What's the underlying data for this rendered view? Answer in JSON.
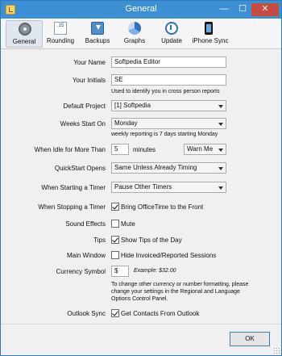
{
  "window": {
    "title": "General",
    "minimize": "—",
    "maximize": "☐",
    "close": "✕"
  },
  "toolbar": {
    "items": [
      {
        "label": "General",
        "icon": "general-icon",
        "active": true
      },
      {
        "label": "Rounding",
        "icon": "rounding-icon",
        "icon_text": ".15"
      },
      {
        "label": "Backups",
        "icon": "backups-icon"
      },
      {
        "label": "Graphs",
        "icon": "graphs-icon"
      },
      {
        "label": "Update",
        "icon": "update-icon"
      },
      {
        "label": "iPhone Sync",
        "icon": "iphone-icon"
      }
    ]
  },
  "form": {
    "your_name": {
      "label": "Your Name",
      "value": "Softpedia Editor"
    },
    "your_initials": {
      "label": "Your Initials",
      "value": "SE",
      "hint": "Used to identify you in cross person reports"
    },
    "default_project": {
      "label": "Default Project",
      "value": "[1] Softpedia"
    },
    "weeks_start_on": {
      "label": "Weeks Start On",
      "value": "Monday",
      "hint": "weekly reporting is 7 days starting Monday"
    },
    "idle": {
      "label": "When Idle for More Than",
      "minutes_value": "5",
      "minutes_label": "minutes",
      "action": "Warn Me"
    },
    "quickstart": {
      "label": "QuickStart Opens",
      "value": "Same Unless Already Timing"
    },
    "start_timer": {
      "label": "When Starting a Timer",
      "value": "Pause Other Timers"
    },
    "stop_timer": {
      "label": "When Stopping a Timer",
      "checkbox_label": "Bring OfficeTime to the Front",
      "checked": true
    },
    "sound_effects": {
      "label": "Sound Effects",
      "checkbox_label": "Mute",
      "checked": false
    },
    "tips": {
      "label": "Tips",
      "checkbox_label": "Show Tips of the Day",
      "checked": true
    },
    "main_window": {
      "label": "Main Window",
      "checkbox_label": "Hide Invoiced/Reported Sessions",
      "checked": false
    },
    "currency": {
      "label": "Currency Symbol",
      "value": "$",
      "example": "Example: $32.00",
      "note_line1": "To change other currency or number formatting, please",
      "note_line2": "change your settings in the Regional and Language",
      "note_line3": "Options Control Panel."
    },
    "outlook_sync": {
      "label": "Outlook Sync",
      "checkbox_label": "Get Contacts From Outlook",
      "checked": true
    }
  },
  "footer": {
    "ok_label": "OK"
  }
}
